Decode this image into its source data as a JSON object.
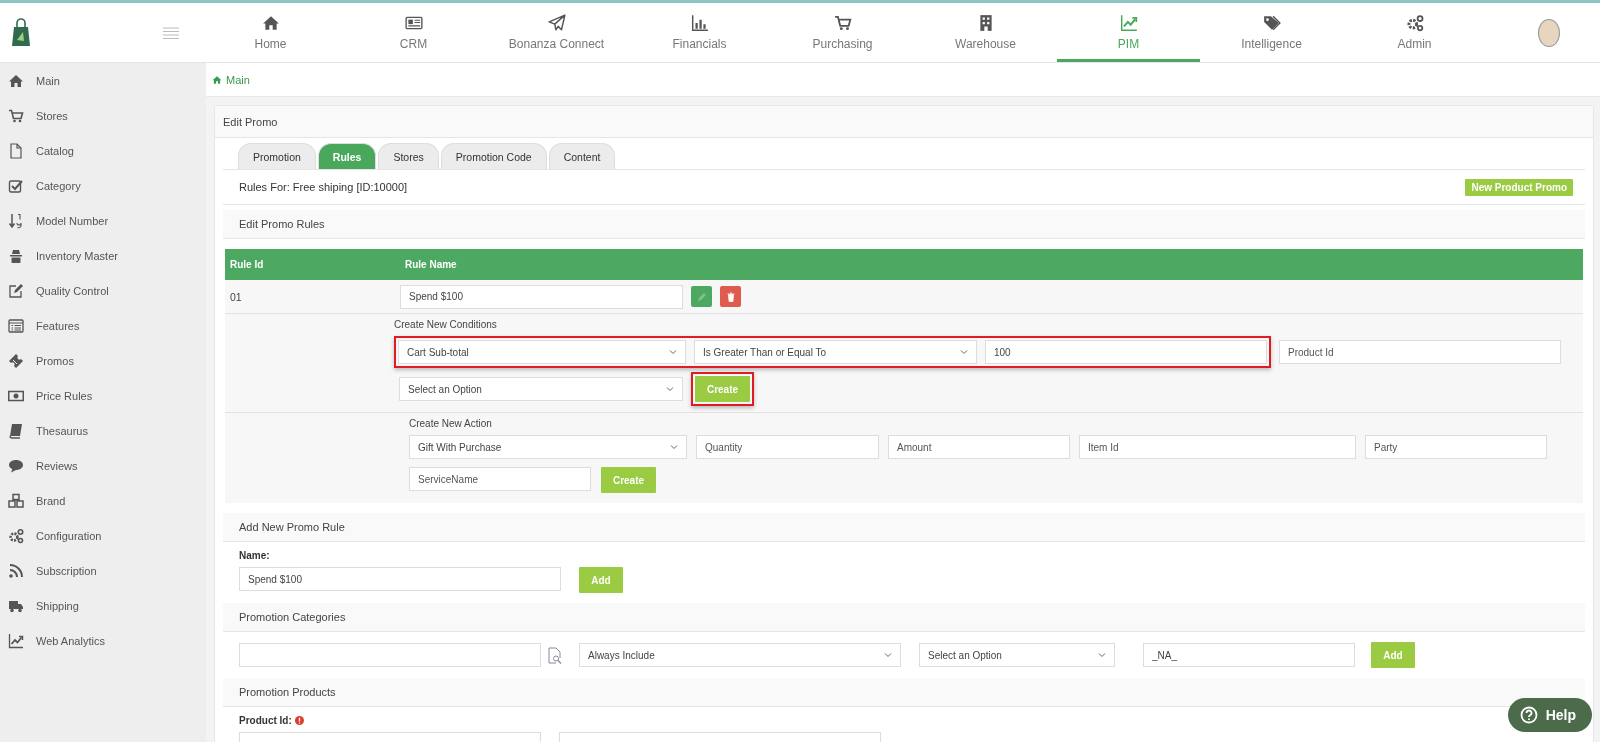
{
  "header": {
    "nav": [
      {
        "label": "Home",
        "selected": false
      },
      {
        "label": "CRM",
        "selected": false
      },
      {
        "label": "Bonanza Connect",
        "selected": false
      },
      {
        "label": "Financials",
        "selected": false
      },
      {
        "label": "Purchasing",
        "selected": false
      },
      {
        "label": "Warehouse",
        "selected": false
      },
      {
        "label": "PIM",
        "selected": true
      },
      {
        "label": "Intelligence",
        "selected": false
      },
      {
        "label": "Admin",
        "selected": false
      }
    ]
  },
  "sidebar": {
    "items": [
      {
        "label": "Main"
      },
      {
        "label": "Stores"
      },
      {
        "label": "Catalog"
      },
      {
        "label": "Category"
      },
      {
        "label": "Model Number"
      },
      {
        "label": "Inventory Master"
      },
      {
        "label": "Quality Control"
      },
      {
        "label": "Features"
      },
      {
        "label": "Promos"
      },
      {
        "label": "Price Rules"
      },
      {
        "label": "Thesaurus"
      },
      {
        "label": "Reviews"
      },
      {
        "label": "Brand"
      },
      {
        "label": "Configuration"
      },
      {
        "label": "Subscription"
      },
      {
        "label": "Shipping"
      },
      {
        "label": "Web Analytics"
      }
    ]
  },
  "breadcrumb": {
    "label": "Main"
  },
  "panel": {
    "title": "Edit Promo",
    "tabs": [
      {
        "label": "Promotion",
        "selected": false
      },
      {
        "label": "Rules",
        "selected": true
      },
      {
        "label": "Stores",
        "selected": false
      },
      {
        "label": "Promotion Code",
        "selected": false
      },
      {
        "label": "Content",
        "selected": false
      }
    ],
    "rules_for": "Rules For: Free shiping [ID:10000]",
    "new_button": "New Product Promo",
    "rules": {
      "title": "Edit Promo Rules",
      "columns": [
        "Rule Id",
        "Rule Name"
      ],
      "rows": [
        {
          "id": "01",
          "name": "Spend $100"
        }
      ],
      "conditions": {
        "title": "Create New Conditions",
        "highlighted": true,
        "fields": [
          {
            "kind": "select",
            "value": "Cart Sub-total"
          },
          {
            "kind": "select",
            "value": "Is Greater Than or Equal To"
          },
          {
            "kind": "input",
            "value": "100"
          }
        ],
        "product_id": {
          "placeholder": "Product Id"
        },
        "option_select": {
          "value": "Select an Option"
        },
        "create_button": {
          "label": "Create",
          "highlighted": true
        }
      },
      "action": {
        "title": "Create New Action",
        "select": {
          "value": "Gift With Purchase"
        },
        "fields": [
          {
            "placeholder": "Quantity"
          },
          {
            "placeholder": "Amount"
          },
          {
            "placeholder": "Item Id"
          },
          {
            "placeholder": "Party"
          },
          {
            "placeholder": "ServiceName"
          }
        ],
        "create_button": {
          "label": "Create"
        }
      }
    },
    "add_rule": {
      "title": "Add New Promo Rule",
      "label": "Name:",
      "value": "Spend $100",
      "button": "Add"
    },
    "categories": {
      "title": "Promotion Categories",
      "select1": "Always Include",
      "select2": "Select an Option",
      "value": "_NA_",
      "button": "Add"
    },
    "products": {
      "title": "Promotion Products",
      "label": "Product Id:",
      "required": true
    }
  },
  "help": {
    "label": "Help"
  }
}
